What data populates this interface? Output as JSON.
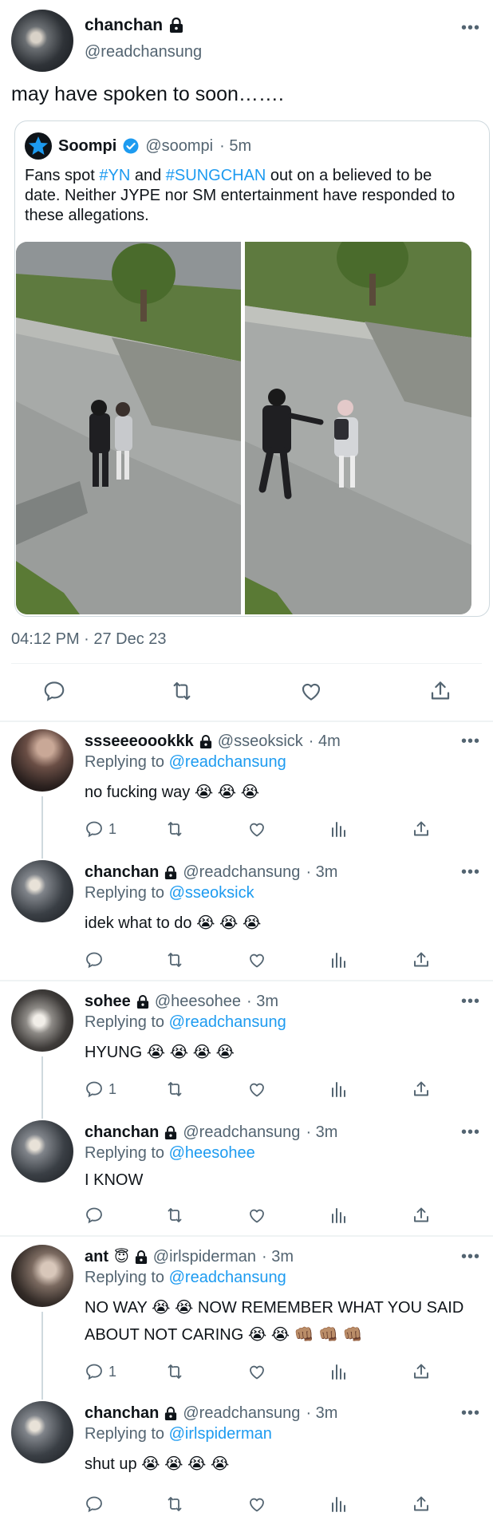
{
  "main_tweet": {
    "display_name": "chanchan",
    "handle": "@readchansung",
    "text": "may have spoken to soon…….",
    "timestamp": "04:12 PM · 27 Dec 23",
    "quote": {
      "name": "Soompi",
      "handle": "@soompi",
      "time": "· 5m",
      "text_pre": "Fans spot ",
      "hashtag1": "#YN",
      "text_mid": " and ",
      "hashtag2": "#SUNGCHAN",
      "text_post": " out on a believed to be date. Neither JYPE nor SM entertainment have responded to these allegations."
    }
  },
  "replies": [
    {
      "name": "ssseeeoookkk",
      "handle": "@sseoksick",
      "time": "· 4m",
      "replying_label": "Replying to",
      "replying_to": "@readchansung",
      "text": "no fucking way 😭 😭 😭",
      "reply_count": "1"
    },
    {
      "name": "chanchan",
      "handle": "@readchansung",
      "time": "· 3m",
      "replying_label": "Replying to",
      "replying_to": "@sseoksick",
      "text": "idek what to do 😭 😭 😭",
      "reply_count": ""
    },
    {
      "name": "sohee",
      "handle": "@heesohee",
      "time": "· 3m",
      "replying_label": "Replying to",
      "replying_to": "@readchansung",
      "text": "HYUNG 😭 😭 😭 😭",
      "reply_count": "1"
    },
    {
      "name": "chanchan",
      "handle": "@readchansung",
      "time": "· 3m",
      "replying_label": "Replying to",
      "replying_to": "@heesohee",
      "text": "I KNOW",
      "reply_count": ""
    },
    {
      "name": "ant",
      "name_emoji": "😇",
      "handle": "@irlspiderman",
      "time": "· 3m",
      "replying_label": "Replying to",
      "replying_to": "@readchansung",
      "text_line1": "NO WAY 😭 😭 NOW REMEMBER WHAT YOU SAID",
      "text_line2": "ABOUT NOT CARING 😭 😭 👊🏽 👊🏽 👊🏽",
      "reply_count": "1"
    },
    {
      "name": "chanchan",
      "handle": "@readchansung",
      "time": "· 3m",
      "replying_label": "Replying to",
      "replying_to": "@irlspiderman",
      "text": "shut up 😭 😭 😭 😭",
      "reply_count": ""
    }
  ],
  "colors": {
    "link": "#1d9bf0",
    "secondary": "#536471",
    "divider": "#eff3f4",
    "verified": "#1d9bf0"
  },
  "icons": [
    "lock-icon",
    "more-icon",
    "reply-icon",
    "retweet-icon",
    "like-icon",
    "share-icon",
    "views-icon",
    "verified-icon"
  ]
}
